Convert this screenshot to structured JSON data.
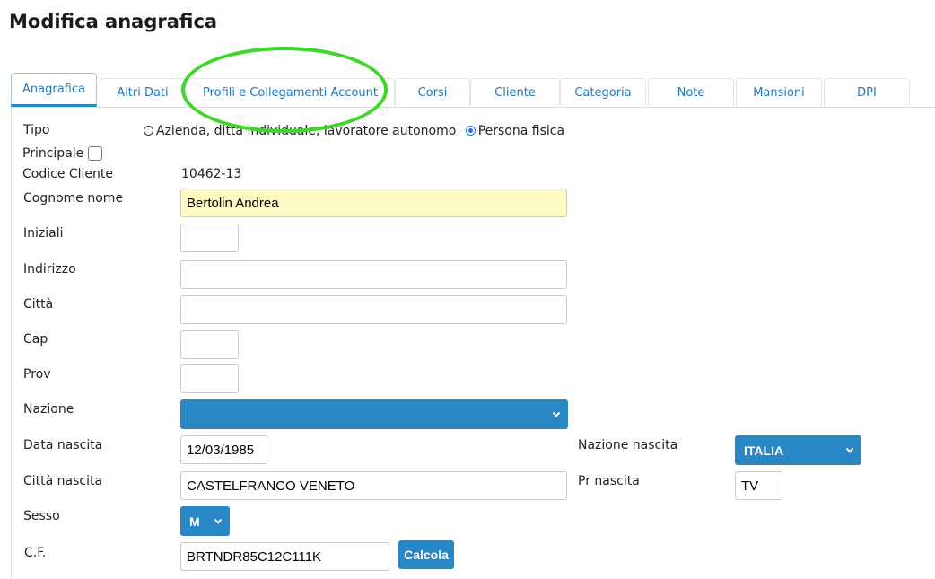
{
  "title": "Modifica anagrafica",
  "tabs": [
    {
      "label": "Anagrafica",
      "active": true
    },
    {
      "label": "Altri Dati"
    },
    {
      "label": "Profili e Collegamenti Account"
    },
    {
      "label": "Corsi"
    },
    {
      "label": "Cliente"
    },
    {
      "label": "Categoria"
    },
    {
      "label": "Note"
    },
    {
      "label": "Mansioni"
    },
    {
      "label": "DPI"
    }
  ],
  "form": {
    "tipo": {
      "label": "Tipo",
      "option_azienda": "Azienda, ditta individuale, lavoratore autonomo",
      "option_persona": "Persona fisica",
      "selected": "Persona fisica"
    },
    "principale": {
      "label": "Principale",
      "checked": false
    },
    "codice_cliente": {
      "label": "Codice Cliente",
      "value": "10462-13"
    },
    "cognome_nome": {
      "label": "Cognome nome",
      "value": "Bertolin Andrea"
    },
    "iniziali": {
      "label": "Iniziali",
      "value": ""
    },
    "indirizzo": {
      "label": "Indirizzo",
      "value": ""
    },
    "citta": {
      "label": "Città",
      "value": ""
    },
    "cap": {
      "label": "Cap",
      "value": ""
    },
    "prov": {
      "label": "Prov",
      "value": ""
    },
    "nazione": {
      "label": "Nazione",
      "value": ""
    },
    "data_nascita": {
      "label": "Data nascita",
      "value": "12/03/1985"
    },
    "nazione_nascita": {
      "label": "Nazione nascita",
      "value": "ITALIA"
    },
    "citta_nascita": {
      "label": "Città nascita",
      "value": "CASTELFRANCO VENETO"
    },
    "pr_nascita": {
      "label": "Pr nascita",
      "value": "TV"
    },
    "sesso": {
      "label": "Sesso",
      "value": "M"
    },
    "cf": {
      "label": "C.F.",
      "value": "BRTNDR85C12C111K",
      "calcola_label": "Calcola"
    }
  },
  "colors": {
    "accent": "#2a87c5",
    "highlight": "#3fd62a",
    "yellow_field": "#fdfbc4"
  },
  "icons": [
    "chevron-down-icon",
    "radio-icon",
    "checkbox-icon"
  ]
}
